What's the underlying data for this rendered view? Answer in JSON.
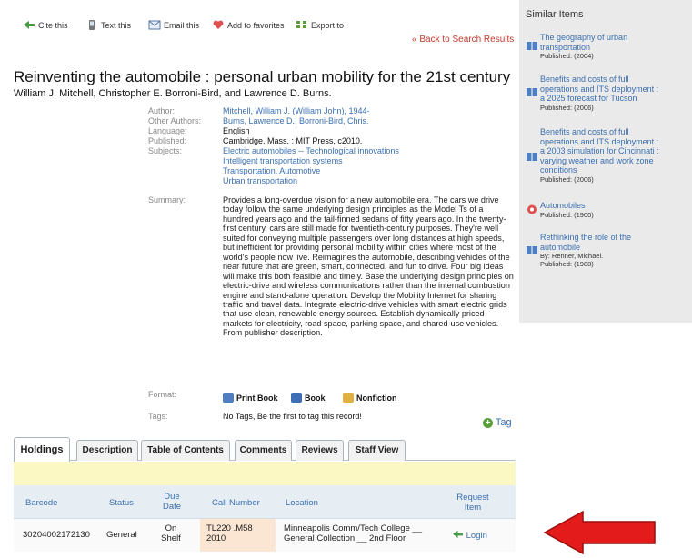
{
  "toolbar": {
    "cite": "Cite this",
    "text": "Text this",
    "email": "Email this",
    "favorites": "Add to favorites",
    "export": "Export to"
  },
  "back_link": "« Back to Search Results",
  "record": {
    "title": "Reinventing the automobile : personal urban mobility for the 21st century",
    "authors_line": "William J. Mitchell, Christopher E. Borroni-Bird, and Lawrence D. Burns.",
    "labels": {
      "author": "Author:",
      "other_authors": "Other Authors:",
      "language": "Language:",
      "published": "Published:",
      "subjects": "Subjects:",
      "summary": "Summary:",
      "format": "Format:",
      "tags": "Tags:"
    },
    "author": "Mitchell, William J. (William John), 1944-",
    "other_authors": "Burns, Lawrence D., Borroni-Bird, Chris.",
    "language": "English",
    "published": "Cambridge, Mass. : MIT Press, c2010.",
    "subjects": [
      "Electric automobiles -- Technological innovations",
      "Intelligent transportation systems",
      "Transportation, Automotive",
      "Urban transportation"
    ],
    "summary": "Provides a long-overdue vision for a new automobile era. The cars we drive today follow the same underlying design principles as the Model Ts of a hundred years ago and the tail-finned sedans of fifty years ago. In the twenty-first century, cars are still made for twentieth-century purposes. They're well suited for conveying multiple passengers over long distances at high speeds, but inefficient for providing personal mobility within cities where most of the world's people now live. Reimagines the automobile, describing vehicles of the near future that are green, smart, connected, and fun to drive. Four big ideas will make this both feasible and timely. Base the underlying design principles on electric-drive and wireless communications rather than the internal combustion engine and stand-alone operation. Develop the Mobility Internet for sharing traffic and travel data. Integrate electric-drive vehicles with smart electric grids that use clean, renewable energy sources. Establish dynamically priced markets for electricity, road space, parking space, and shared-use vehicles. From publisher description.",
    "formats": [
      "Print Book",
      "Book",
      "Nonfiction"
    ],
    "tags": "No Tags, Be the first to tag this record!",
    "tag_button": "Tag"
  },
  "tabs": [
    "Holdings",
    "Description",
    "Table of Contents",
    "Comments",
    "Reviews",
    "Staff View"
  ],
  "holdings": {
    "headers": {
      "barcode": "Barcode",
      "status": "Status",
      "due_1": "Due",
      "due_2": "Date",
      "call_number": "Call Number",
      "location": "Location",
      "request_1": "Request",
      "request_2": "Item"
    },
    "row": {
      "barcode": "30204002172130",
      "status": "General",
      "due_1": "On",
      "due_2": "Shelf",
      "call_1": "TL220 .M58",
      "call_2": "2010",
      "location_1": "Minneapolis Comm/Tech College __",
      "location_2": "General Collection __ 2nd Floor",
      "request": "Login"
    }
  },
  "similar": {
    "heading": "Similar Items",
    "items": [
      {
        "title": [
          "The geography of urban",
          "transportation"
        ],
        "meta": [
          "Published: (2004)"
        ]
      },
      {
        "title": [
          "Benefits and costs of full",
          "operations and ITS deployment :",
          "a 2025 forecast for Tucson"
        ],
        "meta": [
          "Published: (2006)"
        ]
      },
      {
        "title": [
          "Benefits and costs of full",
          "operations and ITS deployment :",
          "a 2003 simulation for Cincinnati :",
          "varying weather and work zone",
          "conditions"
        ],
        "meta": [
          "Published: (2006)"
        ]
      },
      {
        "title": [
          "Automobiles"
        ],
        "meta": [
          "Published: (1900)"
        ]
      },
      {
        "title": [
          "Rethinking the role of the",
          "automobile"
        ],
        "meta": [
          "By: Renner, Michael.",
          "Published: (1988)"
        ]
      }
    ]
  },
  "colors": {
    "link": "#3a6fb0",
    "back_link": "#c0392b",
    "arrow": "#e31b1b",
    "tag_plus": "#5a9e3c"
  }
}
